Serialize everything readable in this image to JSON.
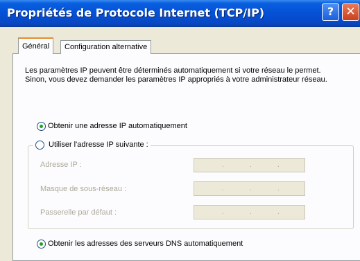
{
  "window": {
    "title": "Propriétés de Protocole Internet (TCP/IP)",
    "help_glyph": "?",
    "close_glyph": "✕"
  },
  "tabs": [
    {
      "label": "Général",
      "active": true
    },
    {
      "label": "Configuration alternative",
      "active": false
    }
  ],
  "intro_text": "Les paramètres IP peuvent être déterminés automatiquement si votre réseau le permet. Sinon, vous devez demander les paramètres IP appropriés à votre administrateur réseau.",
  "ip_mode": {
    "auto_label": "Obtenir une adresse IP automatiquement",
    "manual_label": "Utiliser l'adresse IP suivante :",
    "selected": "auto"
  },
  "fields": [
    {
      "label": "Adresse IP :",
      "value": ""
    },
    {
      "label": "Masque de sous-réseau :",
      "value": ""
    },
    {
      "label": "Passerelle par défaut :",
      "value": ""
    }
  ],
  "dns_mode": {
    "auto_label": "Obtenir les adresses des serveurs DNS automatiquement",
    "selected": "auto"
  },
  "colors": {
    "title_bar": "#0551d6",
    "dialog_bg": "#ece9d8",
    "panel_bg": "#fcfcfe",
    "tab_highlight": "#e68b2c",
    "radio_dot": "#21a121"
  }
}
